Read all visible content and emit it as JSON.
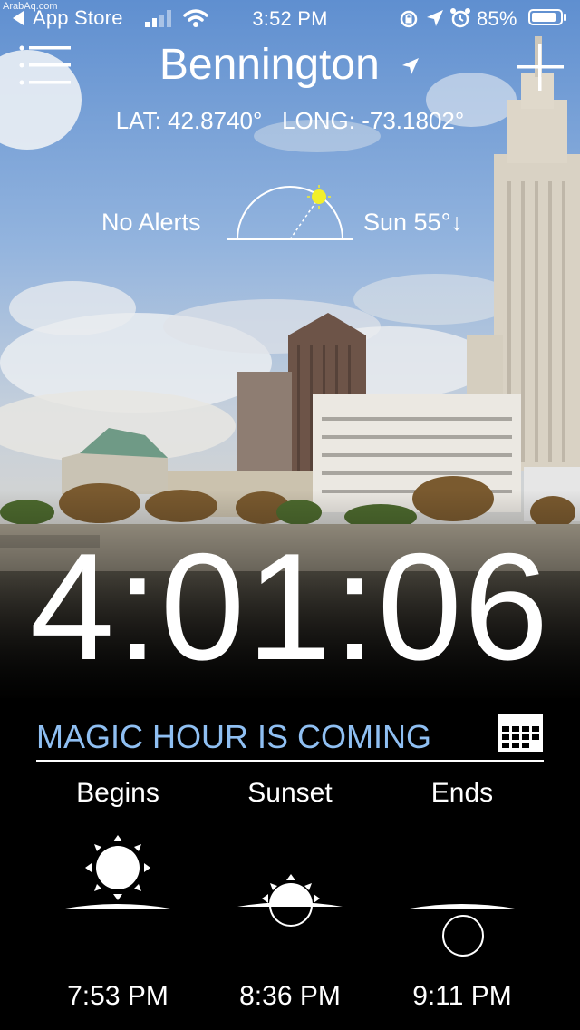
{
  "watermark": "ArabAq.com",
  "status_bar": {
    "back_label": "App Store",
    "time": "3:52 PM",
    "battery_percent": "85%",
    "battery_level": 0.85
  },
  "header": {
    "city": "Bennington",
    "coordinates": "LAT: 42.8740°   LONG: -73.1802°"
  },
  "sun_info": {
    "alerts": "No Alerts",
    "sun_position": "Sun 55°↓"
  },
  "countdown": "4:01:06",
  "magic_hour": {
    "title": "MAGIC HOUR IS COMING",
    "accent_color": "#8fbff2",
    "columns": [
      {
        "label": "Begins",
        "time": "7:53 PM"
      },
      {
        "label": "Sunset",
        "time": "8:36 PM"
      },
      {
        "label": "Ends",
        "time": "9:11 PM"
      }
    ]
  },
  "icons": [
    "navigation-arrow-icon",
    "wifi-icon",
    "signal-icon",
    "orientation-lock-icon",
    "location-icon",
    "alarm-icon",
    "battery-icon",
    "menu-icon",
    "add-icon",
    "calendar-icon",
    "sun-arc-icon",
    "sun-above-horizon-icon",
    "sun-at-horizon-icon",
    "sun-below-horizon-icon"
  ]
}
